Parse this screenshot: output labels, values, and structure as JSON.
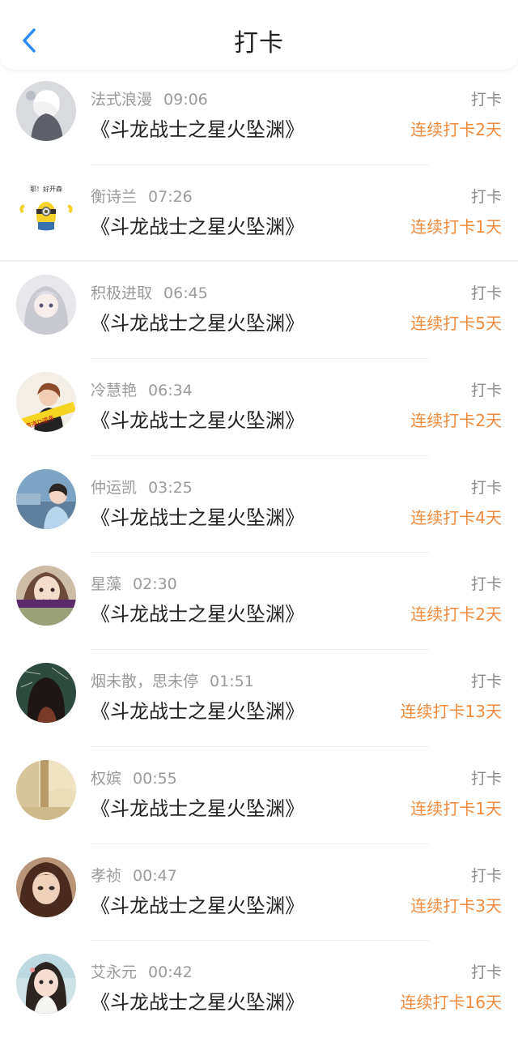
{
  "header": {
    "title": "打卡",
    "back_icon": "chevron-left-icon",
    "accent": "#2b8cf7"
  },
  "colors": {
    "streak": "#f08a3c",
    "meta": "#9a9a9a",
    "text": "#222222"
  },
  "items": [
    {
      "name": "法式浪漫",
      "time": "09:06",
      "book": "《斗龙战士之星火坠渊》",
      "action": "打卡",
      "streak": "连续打卡2天",
      "avatar": "anime-white-hair-avatar"
    },
    {
      "name": "衡诗兰",
      "time": "07:26",
      "book": "《斗龙战士之星火坠渊》",
      "action": "打卡",
      "streak": "连续打卡1天",
      "avatar": "minion-avatar",
      "avatar_text": "耶！好开森"
    },
    {
      "name": "积极进取",
      "time": "06:45",
      "book": "《斗龙战士之星火坠渊》",
      "action": "打卡",
      "streak": "连续打卡5天",
      "avatar": "anime-silver-hair-avatar"
    },
    {
      "name": "冷慧艳",
      "time": "06:34",
      "book": "《斗龙战士之星火坠渊》",
      "action": "打卡",
      "streak": "连续打卡2天",
      "avatar": "woman-photo-avatar",
      "avatar_text": "霸道D道条"
    },
    {
      "name": "仲运凯",
      "time": "03:25",
      "book": "《斗龙战士之星火坠渊》",
      "action": "打卡",
      "streak": "连续打卡4天",
      "avatar": "man-photo-avatar"
    },
    {
      "name": "星藻",
      "time": "02:30",
      "book": "《斗龙战士之星火坠渊》",
      "action": "打卡",
      "streak": "连续打卡2天",
      "avatar": "girl-face-avatar"
    },
    {
      "name": "烟未散，思未停",
      "time": "01:51",
      "book": "《斗龙战士之星火坠渊》",
      "action": "打卡",
      "streak": "连续打卡13天",
      "avatar": "girl-back-chalkboard-avatar"
    },
    {
      "name": "权嫔",
      "time": "00:55",
      "book": "《斗龙战士之星火坠渊》",
      "action": "打卡",
      "streak": "连续打卡1天",
      "avatar": "tree-scenery-avatar"
    },
    {
      "name": "孝祯",
      "time": "00:47",
      "book": "《斗龙战士之星火坠渊》",
      "action": "打卡",
      "streak": "连续打卡3天",
      "avatar": "illustrated-girl-avatar"
    },
    {
      "name": "艾永元",
      "time": "00:42",
      "book": "《斗龙战士之星火坠渊》",
      "action": "打卡",
      "streak": "连续打卡16天",
      "avatar": "anime-girl-avatar"
    }
  ]
}
